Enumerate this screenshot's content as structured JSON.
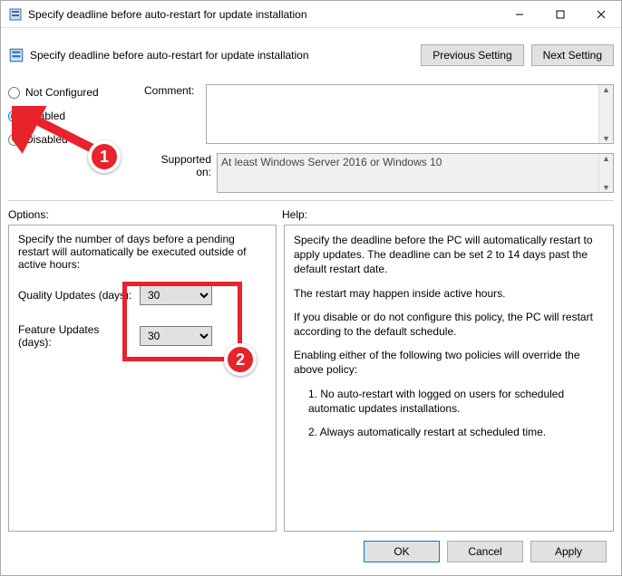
{
  "window": {
    "title": "Specify deadline before auto-restart for update installation"
  },
  "header": {
    "subtitle": "Specify deadline before auto-restart for update installation",
    "prev_btn": "Previous Setting",
    "next_btn": "Next Setting"
  },
  "radios": {
    "not_configured": "Not Configured",
    "enabled": "Enabled",
    "disabled": "Disabled",
    "selected": "enabled"
  },
  "comment": {
    "label": "Comment:",
    "value": ""
  },
  "supported": {
    "label": "Supported on:",
    "value": "At least Windows Server 2016 or Windows 10"
  },
  "panels": {
    "options_label": "Options:",
    "help_label": "Help:"
  },
  "options": {
    "intro": "Specify the number of days before a pending restart will automatically be executed outside of active hours:",
    "quality_label": "Quality Updates (days):",
    "quality_value": "30",
    "feature_label": "Feature Updates (days):",
    "feature_value": "30"
  },
  "help": {
    "p1": "Specify the deadline before the PC will automatically restart to apply updates. The deadline can be set 2 to 14 days past the default restart date.",
    "p2": "The restart may happen inside active hours.",
    "p3": "If you disable or do not configure this policy, the PC will restart according to the default schedule.",
    "p4": "Enabling either of the following two policies will override the above policy:",
    "li1": "1. No auto-restart with logged on users for scheduled automatic updates installations.",
    "li2": "2. Always automatically restart at scheduled time."
  },
  "footer": {
    "ok": "OK",
    "cancel": "Cancel",
    "apply": "Apply"
  },
  "annotations": {
    "badge1": "1",
    "badge2": "2"
  }
}
